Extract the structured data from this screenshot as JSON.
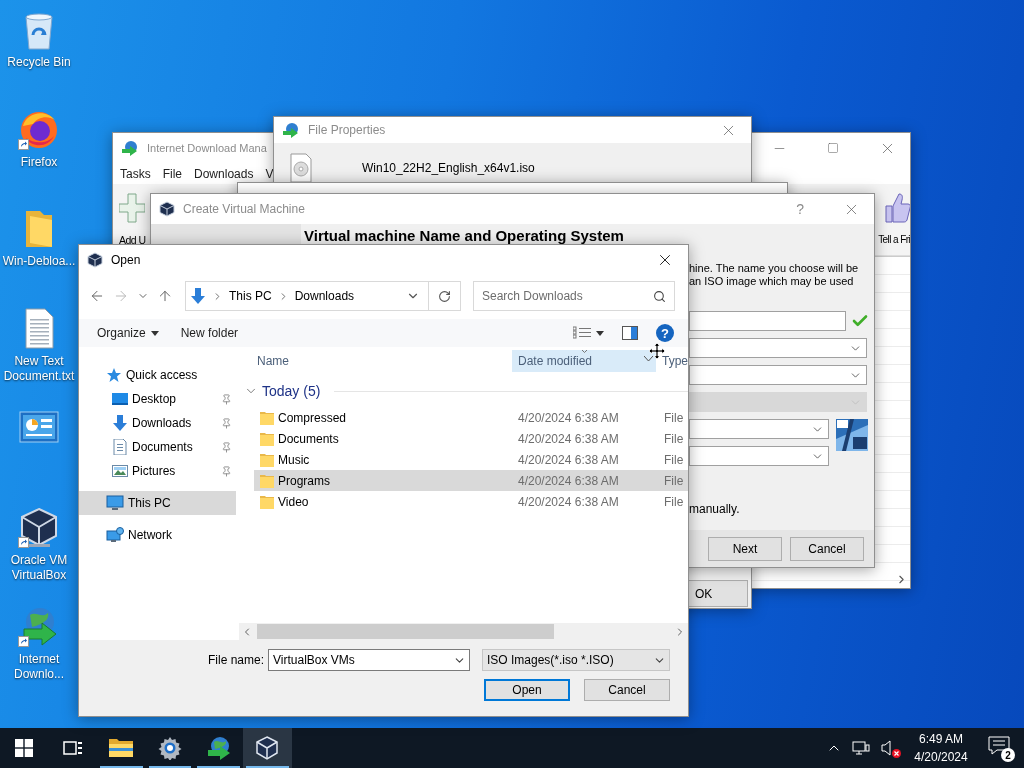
{
  "desktop_icons": [
    {
      "kind": "recycle_bin",
      "label": "Recycle Bin",
      "shortcut": false
    },
    {
      "kind": "firefox",
      "label": "Firefox",
      "shortcut": true
    },
    {
      "kind": "folder",
      "label": "Win-Debloa...",
      "shortcut": false
    },
    {
      "kind": "text_file",
      "label": "New Text Document.txt",
      "shortcut": false
    },
    {
      "kind": "control_panel",
      "shortcut": false
    },
    {
      "kind": "virtualbox",
      "label": "Oracle VM VirtualBox",
      "shortcut": true
    },
    {
      "kind": "idm",
      "label": "Internet Downlo...",
      "shortcut": true
    }
  ],
  "idm_window": {
    "title": "Internet Download Mana",
    "menu": [
      "Tasks",
      "File",
      "Downloads",
      "V"
    ],
    "toolbar": [
      {
        "kind": "add",
        "label": "Add U"
      },
      {
        "kind": "thumbs_up",
        "label": "Tell a Fri"
      }
    ]
  },
  "file_properties": {
    "title": "File Properties",
    "file_name": "Win10_22H2_English_x64v1.iso",
    "button": "OK"
  },
  "create_vm": {
    "title": "Create Virtual Machine",
    "help": "?",
    "heading": "Virtual machine Name and Operating System",
    "description_lines": [
      "hine. The name you choose will be",
      "an ISO image which may be used"
    ],
    "fields": [
      {
        "kind": "text",
        "valid": true
      },
      {
        "kind": "select",
        "disabled": false
      },
      {
        "kind": "select",
        "disabled": false
      },
      {
        "kind": "select",
        "disabled": true
      }
    ],
    "os_fields": [
      {
        "kind": "select",
        "disabled": false
      },
      {
        "kind": "select",
        "disabled": false
      }
    ],
    "note": "manually.",
    "buttons": [
      "Next",
      "Cancel"
    ]
  },
  "open_dialog": {
    "title": "Open",
    "help": "?",
    "path": [
      "This PC",
      "Downloads"
    ],
    "search_placeholder": "Search Downloads",
    "commands": [
      "Organize",
      "New folder"
    ],
    "nav": [
      {
        "kind": "quick_access",
        "label": "Quick access",
        "selected": false,
        "children": [
          {
            "kind": "desktop",
            "label": "Desktop",
            "pinned": true,
            "selected": false
          },
          {
            "kind": "downloads",
            "label": "Downloads",
            "pinned": true,
            "selected": false
          },
          {
            "kind": "documents",
            "label": "Documents",
            "pinned": true,
            "selected": false
          },
          {
            "kind": "pictures",
            "label": "Pictures",
            "pinned": true,
            "selected": false
          }
        ]
      },
      {
        "kind": "pc",
        "label": "This PC",
        "selected": true
      },
      {
        "kind": "network",
        "label": "Network",
        "selected": false
      }
    ],
    "columns": [
      {
        "label": "Name",
        "sorted": false
      },
      {
        "label": "Date modified",
        "sorted": true
      },
      {
        "label": "Type",
        "sorted": false
      }
    ],
    "group": "Today (5)",
    "files": [
      {
        "name": "Compressed",
        "date": "4/20/2024 6:38 AM",
        "type": "File",
        "selected": false
      },
      {
        "name": "Documents",
        "date": "4/20/2024 6:38 AM",
        "type": "File",
        "selected": false
      },
      {
        "name": "Music",
        "date": "4/20/2024 6:38 AM",
        "type": "File",
        "selected": false
      },
      {
        "name": "Programs",
        "date": "4/20/2024 6:38 AM",
        "type": "File",
        "selected": true
      },
      {
        "name": "Video",
        "date": "4/20/2024 6:38 AM",
        "type": "File",
        "selected": false
      }
    ],
    "file_name_label": "File name:",
    "file_name": "VirtualBox VMs",
    "filter": "ISO Images(*.iso *.ISO)",
    "buttons": [
      {
        "label": "Open",
        "default": true
      },
      {
        "label": "Cancel",
        "default": false
      }
    ]
  },
  "taskbar": {
    "apps": [
      {
        "kind": "start",
        "selected": false
      },
      {
        "kind": "task_view",
        "selected": false
      },
      {
        "kind": "explorer",
        "running": true,
        "selected": false
      },
      {
        "kind": "settings",
        "running": true,
        "selected": false
      },
      {
        "kind": "idm",
        "running": true,
        "selected": false
      },
      {
        "kind": "virtualbox",
        "running": true,
        "selected": true
      }
    ],
    "volume_muted": true,
    "time": "6:49 AM",
    "date": "4/20/2024",
    "notification_count": "2"
  }
}
